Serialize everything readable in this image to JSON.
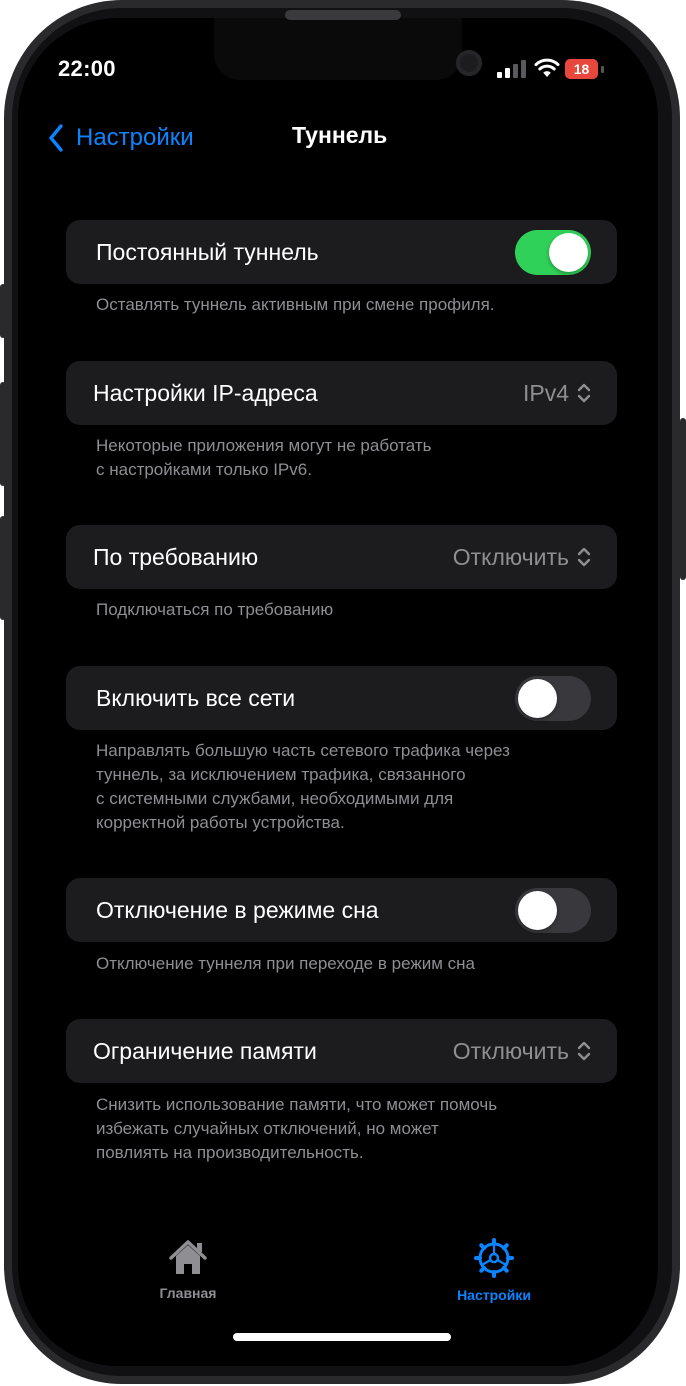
{
  "status": {
    "time": "22:00",
    "battery": "18"
  },
  "nav": {
    "back_label": "Настройки",
    "title": "Туннель"
  },
  "sections": [
    {
      "label": "Постоянный туннель",
      "control": "toggle",
      "on": true,
      "footer": [
        "Оставлять туннель активным при смене профиля."
      ]
    },
    {
      "label": "Настройки IP-адреса",
      "control": "picker",
      "value": "IPv4",
      "footer": [
        "Некоторые приложения могут не работать",
        "с настройками только IPv6."
      ]
    },
    {
      "label": "По требованию",
      "control": "picker",
      "value": "Отключить",
      "footer": [
        "Подключаться по требованию"
      ]
    },
    {
      "label": "Включить все сети",
      "control": "toggle",
      "on": false,
      "footer": [
        "Направлять большую часть сетевого трафика через",
        "туннель, за исключением трафика, связанного",
        "с системными службами, необходимыми для",
        "корректной работы устройства."
      ]
    },
    {
      "label": "Отключение в режиме сна",
      "control": "toggle",
      "on": false,
      "footer": [
        "Отключение туннеля при переходе в режим сна"
      ]
    },
    {
      "label": "Ограничение памяти",
      "control": "picker",
      "value": "Отключить",
      "footer": [
        "Снизить использование памяти, что может помочь",
        "избежать случайных отключений, но может",
        "повлиять на производительность."
      ]
    }
  ],
  "tabs": [
    {
      "label": "Главная",
      "icon": "house-icon",
      "active": false
    },
    {
      "label": "Настройки",
      "icon": "gear-icon",
      "active": true
    }
  ],
  "colors": {
    "accent": "#0a84ff",
    "toggle_on": "#30d158",
    "inactive_tab": "#8e8e93",
    "battery_low": "#e8473b"
  }
}
